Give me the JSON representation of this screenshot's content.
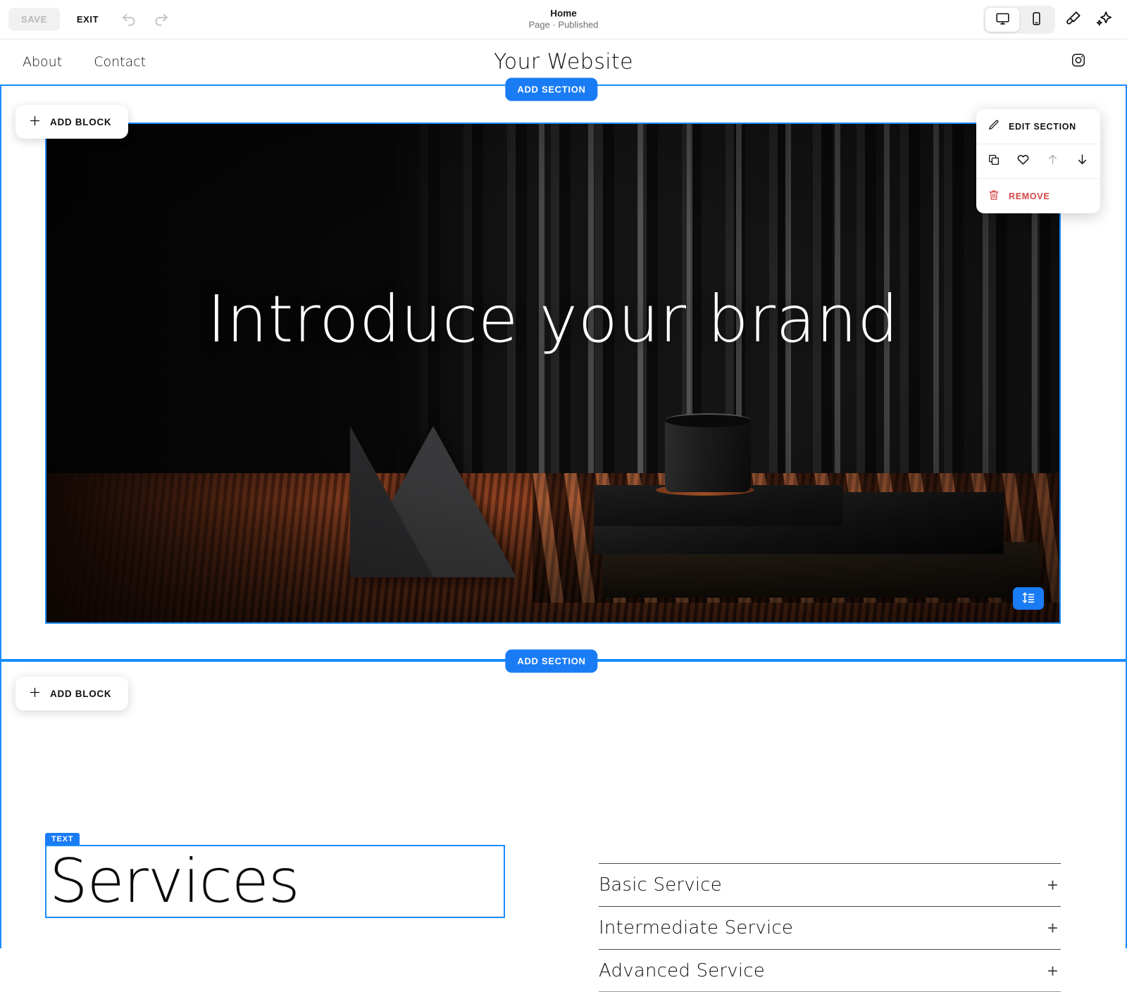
{
  "editor": {
    "save_label": "SAVE",
    "exit_label": "EXIT",
    "undo_icon": "undo-icon",
    "redo_icon": "redo-icon",
    "page_name": "Home",
    "page_status": "Page · Published",
    "device_desktop_icon": "desktop-icon",
    "device_mobile_icon": "mobile-icon",
    "theme_icon": "paintbrush-icon",
    "ai_icon": "sparkle-icon",
    "active_device": "desktop"
  },
  "site_header": {
    "nav": [
      {
        "label": "About"
      },
      {
        "label": "Contact"
      }
    ],
    "logo": "Your Website",
    "social_icon": "instagram-icon"
  },
  "canvas": {
    "add_section_top_label": "ADD SECTION",
    "add_section_bottom_label": "ADD SECTION",
    "add_block_top_label": "ADD BLOCK",
    "add_block_bottom_label": "ADD BLOCK",
    "selection_color": "#1a8cff",
    "accent_color": "#1a7cf5"
  },
  "section_panel": {
    "edit_label": "EDIT SECTION",
    "edit_icon": "pencil-icon",
    "duplicate_icon": "duplicate-icon",
    "favorite_icon": "heart-icon",
    "move_up_icon": "arrow-up-icon",
    "move_down_icon": "arrow-down-icon",
    "remove_label": "REMOVE",
    "remove_icon": "trash-icon",
    "remove_color": "#d64545"
  },
  "hero": {
    "title": "Introduce your brand",
    "size_handle_icon": "section-height-icon"
  },
  "services": {
    "block_badge": "TEXT",
    "title": "Services",
    "items": [
      {
        "label": "Basic Service",
        "toggle_icon": "plus-icon"
      },
      {
        "label": "Intermediate Service",
        "toggle_icon": "plus-icon"
      },
      {
        "label": "Advanced Service",
        "toggle_icon": "plus-icon"
      }
    ]
  }
}
